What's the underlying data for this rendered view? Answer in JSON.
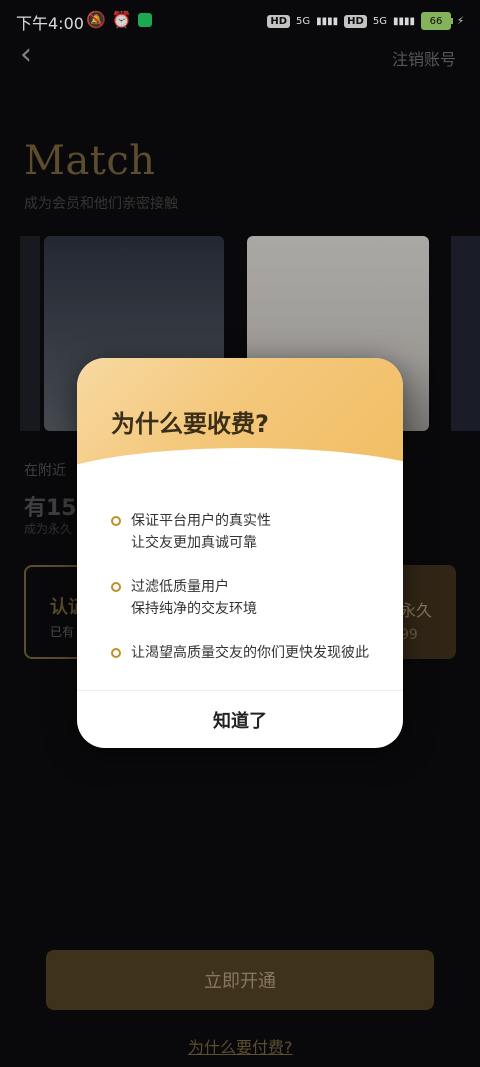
{
  "status": {
    "time": "下午4:00",
    "left_icons": [
      "bell-off-icon",
      "alarm-icon",
      "green-chat-icon"
    ],
    "right_badges": [
      "HD",
      "5G",
      "HD",
      "5G"
    ],
    "battery": "66",
    "charging": true
  },
  "header": {
    "cancel_text": "注销账号"
  },
  "brand": {
    "title": "Match",
    "subtitle": "成为会员和他们亲密接触"
  },
  "nearby": {
    "label": "在附近",
    "count_text": "有15",
    "hint": "成为永久"
  },
  "options": {
    "left_title": "认证",
    "left_desc": "已有",
    "right_title": "永久",
    "right_desc": "99"
  },
  "bottom": {
    "cta": "立即开通",
    "why_link": "为什么要付费?"
  },
  "modal": {
    "title": "为什么要收费?",
    "items": [
      {
        "line1": "保证平台用户的真实性",
        "line2": "让交友更加真诚可靠"
      },
      {
        "line1": "过滤低质量用户",
        "line2": "保持纯净的交友环境"
      },
      {
        "line1": "让渴望高质量交友的你们更快发现彼此",
        "line2": ""
      }
    ],
    "ok": "知道了"
  },
  "colors": {
    "gold": "#c38e29",
    "modal_header": "#f4c77a",
    "background": "#0b0b0d"
  }
}
